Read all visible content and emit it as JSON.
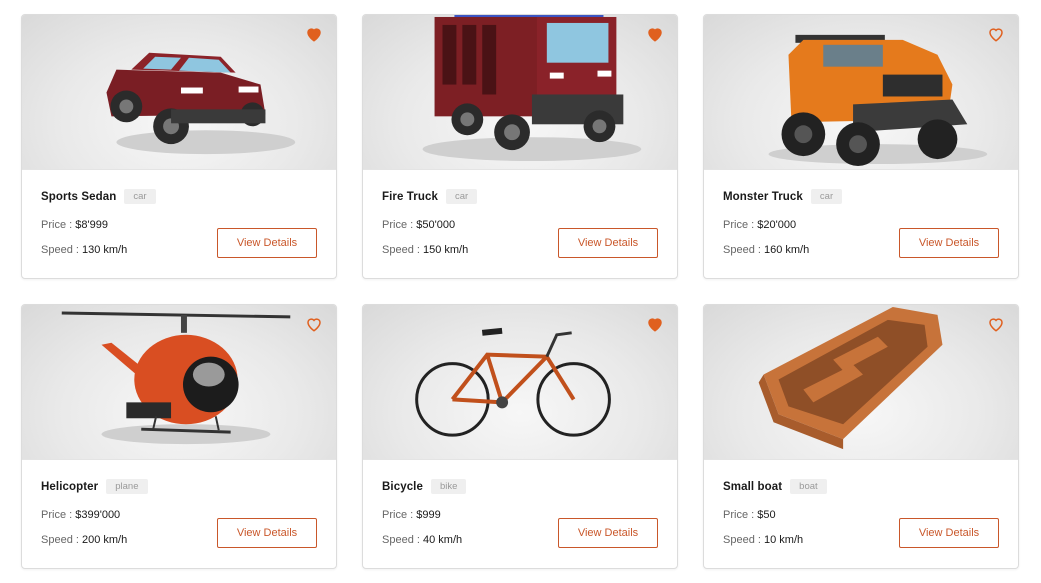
{
  "colors": {
    "accent": "#e0601f",
    "border": "#dcdcdc"
  },
  "labels": {
    "price": "Price :",
    "speed": "Speed :",
    "button": "View Details"
  },
  "products": [
    {
      "title": "Sports Sedan",
      "tag": "car",
      "price": "$8'999",
      "speed": "130 km/h",
      "favorited": true,
      "image": "red-sedan"
    },
    {
      "title": "Fire Truck",
      "tag": "car",
      "price": "$50'000",
      "speed": "150 km/h",
      "favorited": true,
      "image": "fire-truck"
    },
    {
      "title": "Monster Truck",
      "tag": "car",
      "price": "$20'000",
      "speed": "160 km/h",
      "favorited": false,
      "image": "orange-monster-truck"
    },
    {
      "title": "Helicopter",
      "tag": "plane",
      "price": "$399'000",
      "speed": "200 km/h",
      "favorited": false,
      "image": "orange-helicopter"
    },
    {
      "title": "Bicycle",
      "tag": "bike",
      "price": "$999",
      "speed": "40 km/h",
      "favorited": true,
      "image": "orange-bicycle"
    },
    {
      "title": "Small boat",
      "tag": "boat",
      "price": "$50",
      "speed": "10 km/h",
      "favorited": false,
      "image": "wooden-boat"
    }
  ]
}
